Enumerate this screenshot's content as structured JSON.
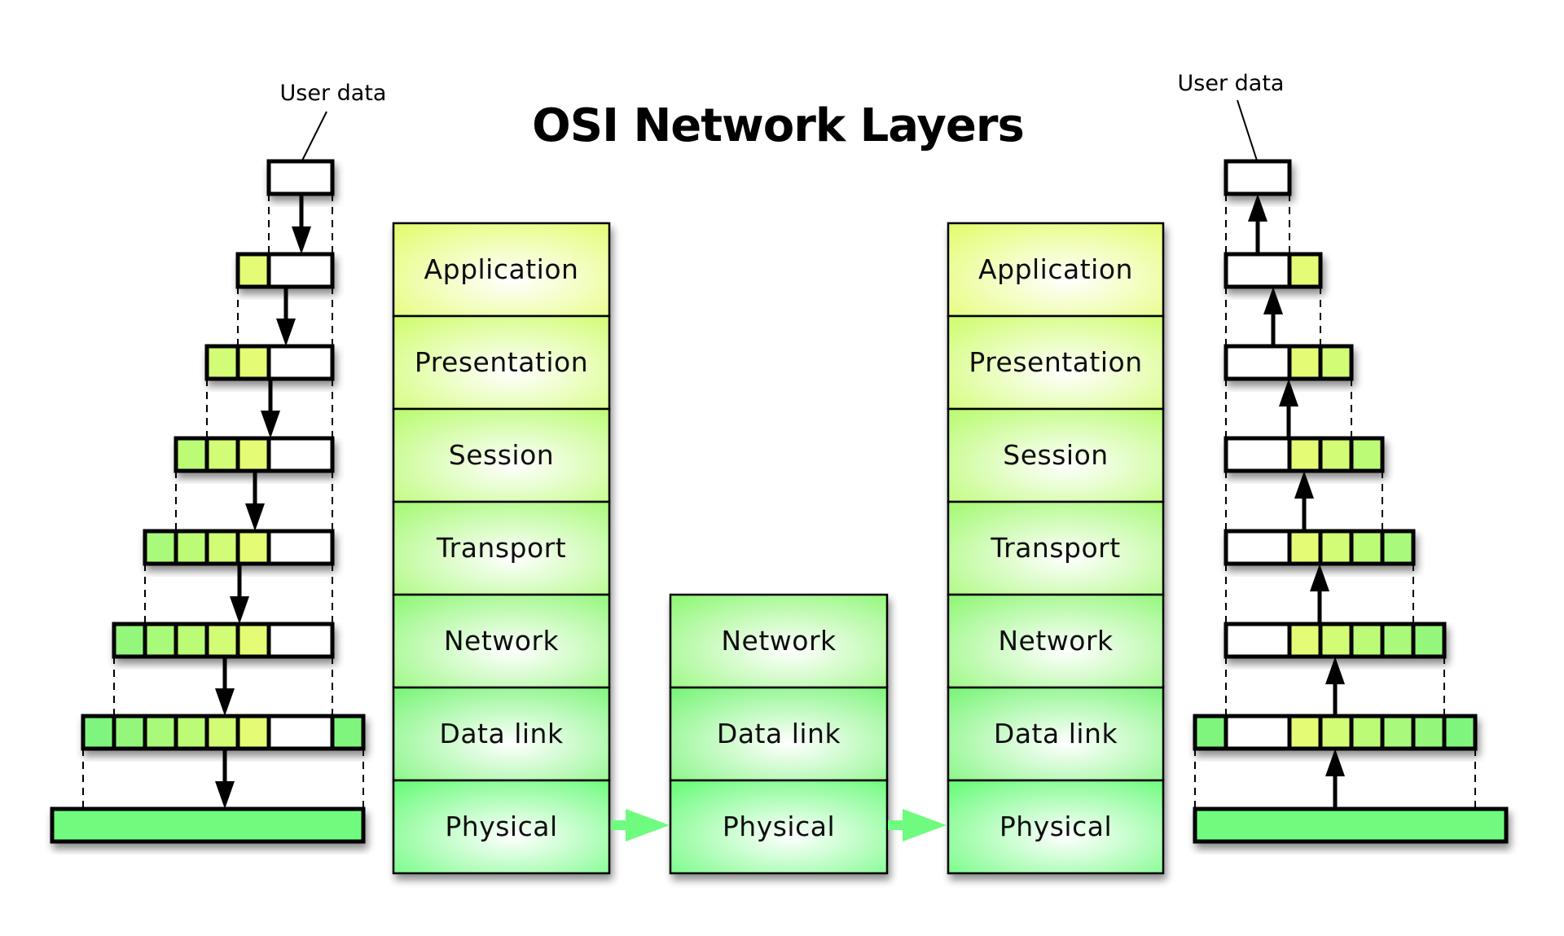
{
  "title": "OSI Network Layers",
  "labels": {
    "left_user_data": "User data",
    "right_user_data": "User data"
  },
  "colors": {
    "application": "#e4fc74",
    "presentation": "#d2fc74",
    "session": "#bcfb76",
    "transport": "#a9f97a",
    "network": "#94f77c",
    "datalink": "#80f57e",
    "physical": "#6ffb7f",
    "userdata": "#ffffff",
    "border": "#000000"
  },
  "stacks": {
    "sender": {
      "layers": [
        {
          "key": "application",
          "label": "Application"
        },
        {
          "key": "presentation",
          "label": "Presentation"
        },
        {
          "key": "session",
          "label": "Session"
        },
        {
          "key": "transport",
          "label": "Transport"
        },
        {
          "key": "network",
          "label": "Network"
        },
        {
          "key": "datalink",
          "label": "Data link"
        },
        {
          "key": "physical",
          "label": "Physical"
        }
      ]
    },
    "router": {
      "layers": [
        {
          "key": "network",
          "label": "Network"
        },
        {
          "key": "datalink",
          "label": "Data link"
        },
        {
          "key": "physical",
          "label": "Physical"
        }
      ]
    },
    "receiver": {
      "layers": [
        {
          "key": "application",
          "label": "Application"
        },
        {
          "key": "presentation",
          "label": "Presentation"
        },
        {
          "key": "session",
          "label": "Session"
        },
        {
          "key": "transport",
          "label": "Transport"
        },
        {
          "key": "network",
          "label": "Network"
        },
        {
          "key": "datalink",
          "label": "Data link"
        },
        {
          "key": "physical",
          "label": "Physical"
        }
      ]
    }
  },
  "encapsulation": {
    "direction_sender": "down",
    "direction_receiver": "up",
    "packets": [
      {
        "stage": "user data",
        "headers": [],
        "trailers": []
      },
      {
        "stage": "application",
        "headers": [
          "application"
        ],
        "trailers": []
      },
      {
        "stage": "presentation",
        "headers": [
          "presentation",
          "application"
        ],
        "trailers": []
      },
      {
        "stage": "session",
        "headers": [
          "session",
          "presentation",
          "application"
        ],
        "trailers": []
      },
      {
        "stage": "transport",
        "headers": [
          "transport",
          "session",
          "presentation",
          "application"
        ],
        "trailers": []
      },
      {
        "stage": "network",
        "headers": [
          "network",
          "transport",
          "session",
          "presentation",
          "application"
        ],
        "trailers": []
      },
      {
        "stage": "data link",
        "headers": [
          "datalink",
          "network",
          "transport",
          "session",
          "presentation",
          "application"
        ],
        "trailers": [
          "datalink"
        ]
      },
      {
        "stage": "physical",
        "bitstream": true
      }
    ]
  },
  "transmission": {
    "path": [
      "sender.physical",
      "router.physical",
      "receiver.physical"
    ]
  }
}
